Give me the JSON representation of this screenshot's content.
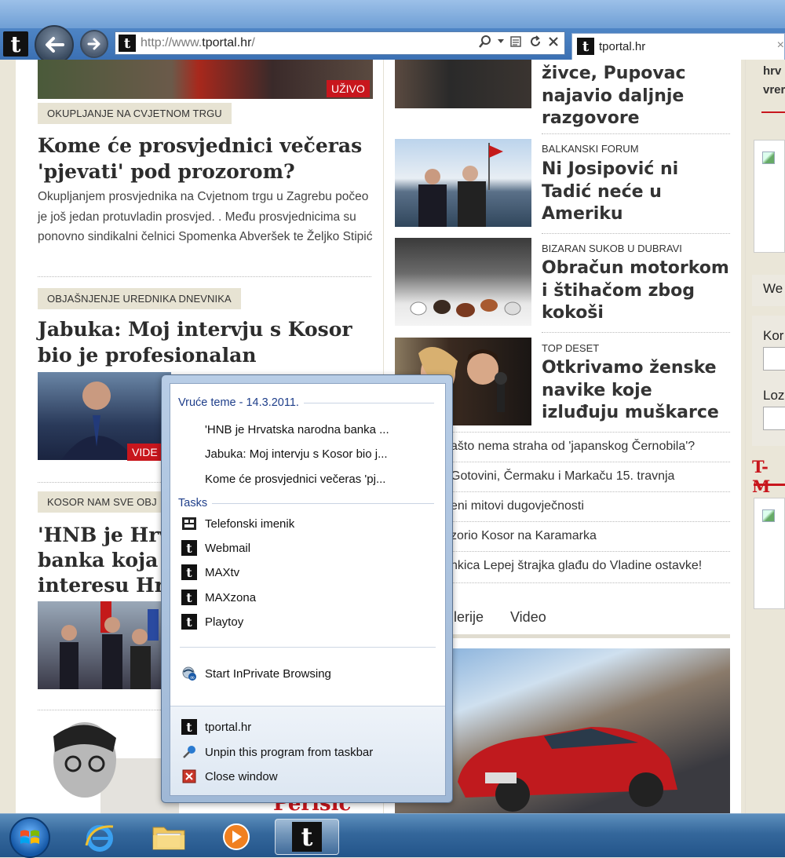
{
  "browser": {
    "url_prefix": "http://www.",
    "url_domain": "tportal.hr",
    "url_suffix": "/",
    "tab_title": "tportal.hr",
    "tab_close": "×",
    "logo_glyph": "t"
  },
  "left_column": {
    "uzivo_badge": "UŽIVO",
    "article1": {
      "label": "OKUPLJANJE NA CVJETNOM TRGU",
      "title": "Kome će prosvjednici večeras 'pjevati' pod prozorom?",
      "summary": "Okupljanjem prosvjednika na Cvjetnom trgu u Zagrebu počeo je još jedan protuvladin prosvjed. . Među prosvjednicima su ponovno sindikalni čelnici Spomenka Abveršek te Željko Stipić"
    },
    "article2": {
      "label": "OBJAŠNJENJE UREDNIKA DNEVNIKA",
      "title": "Jabuka: Moj intervju s Kosor bio je profesionalan",
      "video_badge": "VIDE"
    },
    "article3": {
      "label": "KOSOR NAM SVE OBJ",
      "title_line1": "'HNB je Hrv",
      "title_line2": "banka koja",
      "title_line3": "interesu Hr"
    },
    "bottom_text": "Perišić"
  },
  "middle_column": {
    "top_headline": "živce, Pupovac najavio daljnje razgovore",
    "stories": [
      {
        "label": "BALKANSKI FORUM",
        "title": "Ni Josipović ni Tadić neće u Ameriku"
      },
      {
        "label": "BIZARAN SUKOB U DUBRAVI",
        "title": "Obračun motorkom i štihačom zbog kokoši"
      },
      {
        "label": "TOP DESET",
        "title": "Otkrivamo ženske navike koje izluđuju muškarce"
      }
    ],
    "list": [
      "ašto nema straha od 'japanskog Černobila'?",
      "Gotovini, Čermaku i Markaču 15. travnja",
      "eni mitovi dugovječnosti",
      "zorio Kosor na Karamarka",
      "nkica Lepej štrajka glađu do Vladine ostavke!"
    ],
    "gallery_tabs": [
      "lerije",
      "Video"
    ]
  },
  "right_column": {
    "top_text_line1": "hrv",
    "top_text_line2": "vrer",
    "we_label": "We",
    "kor_label": "Kor",
    "loz_label": "Loz",
    "tm_label": "T-M"
  },
  "jump_list": {
    "recent_header": "Vruće teme - 14.3.2011.",
    "recent_items": [
      "'HNB je Hrvatska narodna banka ...",
      "Jabuka: Moj intervju s Kosor bio j...",
      "Kome će prosvjednici večeras 'pj..."
    ],
    "tasks_header": "Tasks",
    "tasks": [
      {
        "label": "Telefonski imenik",
        "icon": "phonebook-icon"
      },
      {
        "label": "Webmail",
        "icon": "tportal-icon"
      },
      {
        "label": "MAXtv",
        "icon": "tportal-icon"
      },
      {
        "label": "MAXzona",
        "icon": "tportal-icon"
      },
      {
        "label": "Playtoy",
        "icon": "tportal-icon"
      }
    ],
    "inprivate": "Start InPrivate Browsing",
    "bottom_items": [
      {
        "label": "tportal.hr",
        "icon": "tportal-icon"
      },
      {
        "label": "Unpin this program from taskbar",
        "icon": "unpin-icon"
      },
      {
        "label": "Close window",
        "icon": "close-window-icon"
      }
    ]
  }
}
